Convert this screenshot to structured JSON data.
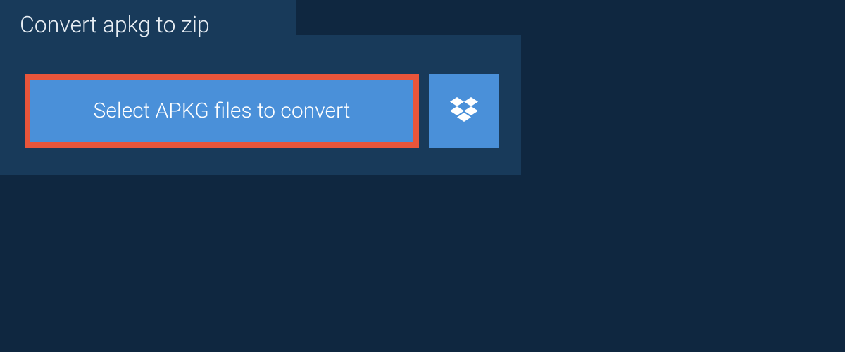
{
  "tab": {
    "label": "Convert apkg to zip"
  },
  "actions": {
    "select_files_label": "Select APKG files to convert"
  }
}
